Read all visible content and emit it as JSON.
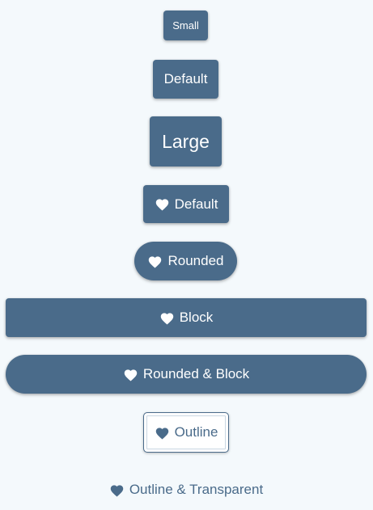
{
  "colors": {
    "background": "#f4f9fc",
    "primary": "#4a6b8a",
    "on_primary": "#ffffff"
  },
  "buttons": {
    "small": {
      "label": "Small"
    },
    "default": {
      "label": "Default"
    },
    "large": {
      "label": "Large"
    },
    "icon_default": {
      "label": "Default",
      "icon": "heart-icon"
    },
    "rounded": {
      "label": "Rounded",
      "icon": "heart-icon"
    },
    "block": {
      "label": "Block",
      "icon": "heart-icon"
    },
    "rounded_block": {
      "label": "Rounded & Block",
      "icon": "heart-icon"
    },
    "outline": {
      "label": "Outline",
      "icon": "heart-icon"
    },
    "outline_transparent": {
      "label": "Outline & Transparent",
      "icon": "heart-icon"
    }
  }
}
